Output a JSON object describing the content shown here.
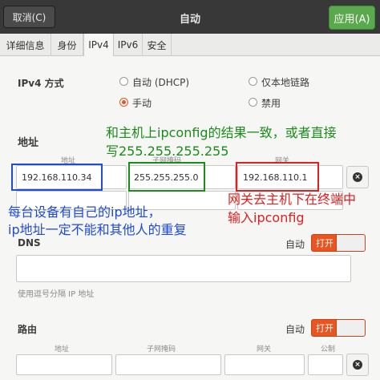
{
  "header": {
    "cancel_label": "取消(C)",
    "title": "自动",
    "apply_label": "应用(A)"
  },
  "tabs": [
    {
      "label": "详细信息"
    },
    {
      "label": "身份"
    },
    {
      "label": "IPv4",
      "active": true
    },
    {
      "label": "IPv6"
    },
    {
      "label": "安全"
    }
  ],
  "ipv4": {
    "method_label": "IPv4 方式",
    "options": {
      "auto_dhcp": "自动 (DHCP)",
      "link_local": "仅本地链路",
      "manual": "手动",
      "disabled": "禁用"
    },
    "selected": "manual"
  },
  "address": {
    "section_label": "地址",
    "col_address": "地址",
    "col_netmask": "子网掩码",
    "col_gateway": "网关",
    "row1": {
      "address": "192.168.110.34",
      "netmask": "255.255.255.0",
      "gateway": "192.168.110.1"
    }
  },
  "dns": {
    "label": "DNS",
    "auto_label": "自动",
    "toggle_label": "打开",
    "hint": "使用逗号分隔 IP 地址"
  },
  "routes": {
    "label": "路由",
    "auto_label": "自动",
    "toggle_label": "打开",
    "col_address": "地址",
    "col_netmask": "子网掩码",
    "col_gateway": "网关",
    "col_metric": "公制"
  },
  "annotations": {
    "green_line1": "和主机上ipconfig的结果一致，或者直接",
    "green_line2": "写255.255.255.255",
    "blue_line1": "每台设备有自己的ip地址，",
    "blue_line2": "ip地址一定不能和其他人的重复",
    "red_line1": "网关去主机下在终端中",
    "red_line2": "输入ipconfig"
  },
  "colors": {
    "accent": "#e95420",
    "apply": "#5aa94d",
    "annotation_green": "#1a8c1a",
    "annotation_blue": "#1f4bd6",
    "annotation_red": "#e02020"
  },
  "icons": {
    "clear": "x-circle-icon"
  }
}
